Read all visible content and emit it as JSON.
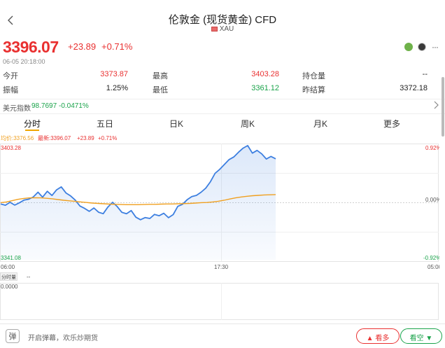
{
  "header": {
    "title": "伦敦金 (现货黄金) CFD",
    "code": "XAU",
    "back_icon": "chevron-left-icon"
  },
  "quote": {
    "price": "3396.07",
    "change": "+23.89",
    "change_pct": "+0.71%",
    "datetime": "06-05 20:18:00"
  },
  "stats": [
    {
      "label": "今开",
      "value": "3373.87",
      "label2": "最高",
      "value2": "3403.28",
      "label3": "持仓量",
      "value3": "--"
    },
    {
      "label": "振幅",
      "value": "1.25%",
      "label2": "最低",
      "value2": "3361.12",
      "label3": "昨结算",
      "value3": "3372.18"
    }
  ],
  "usd_index": {
    "label": "美元指数",
    "value": "98.7697",
    "change_pct": "-0.0471%"
  },
  "tabs": [
    "分时",
    "五日",
    "日K",
    "周K",
    "月K",
    "更多"
  ],
  "active_tab": 0,
  "chart_legend": {
    "avg": "均价:3376.56",
    "latest": "最新:3396.07",
    "change": "+23.89",
    "change_pct": "+0.71%"
  },
  "chart_data": {
    "type": "line",
    "y_max_label": "3403.28",
    "y_min_label": "3341.08",
    "pct_top": "0.92%",
    "pct_mid": "0.00%",
    "pct_bottom": "-0.92%",
    "x_labels": [
      "06:00",
      "17:30",
      "05:00"
    ],
    "ylim": [
      3341.08,
      3403.28
    ],
    "prev_close": 3372.18,
    "series": [
      {
        "values": [
          3371.5,
          3370.8,
          3372.4,
          3370.9,
          3372.1,
          3373.6,
          3374.1,
          3375.3,
          3377.9,
          3375.2,
          3378.4,
          3376.1,
          3379.2,
          3380.8,
          3377.5,
          3375.9,
          3373.6,
          3370.4,
          3369.1,
          3367.5,
          3369.3,
          3367.0,
          3366.2,
          3369.8,
          3372.4,
          3370.1,
          3366.9,
          3366.2,
          3367.9,
          3364.3,
          3362.9,
          3364.1,
          3363.6,
          3365.8,
          3365.1,
          3366.4,
          3364.0,
          3365.7,
          3370.2,
          3371.3,
          3373.8,
          3375.5,
          3376.2,
          3377.9,
          3380.1,
          3383.6,
          3388.2,
          3390.4,
          3393.0,
          3395.7,
          3397.1,
          3399.6,
          3401.9,
          3403.3,
          3399.2,
          3400.7,
          3398.8,
          3396.0,
          3397.4,
          3396.1
        ]
      },
      {
        "values": [
          3372.2,
          3372.6,
          3373.3,
          3374.0,
          3374.5,
          3374.8,
          3374.9,
          3374.8,
          3374.6,
          3374.3,
          3373.9,
          3373.5,
          3373.2,
          3372.9,
          3372.6,
          3372.3,
          3372.0,
          3371.8,
          3371.6,
          3371.4,
          3371.3,
          3371.2,
          3371.1,
          3371.1,
          3371.1,
          3371.2,
          3371.3,
          3371.3,
          3371.4,
          3371.5,
          3371.5,
          3371.6,
          3371.7,
          3371.8,
          3372.0,
          3372.2,
          3372.3,
          3372.6,
          3373.0,
          3373.5,
          3374.2,
          3374.8,
          3375.3,
          3375.7,
          3376.0,
          3376.2,
          3376.4,
          3376.5,
          3376.6
        ]
      }
    ]
  },
  "volume": {
    "label": "分时量",
    "value": "--",
    "axis": "0.0000"
  },
  "bottom": {
    "danmu_icon": "弹",
    "danmu_text": "开启弹幕，欢乐炒期货",
    "bull": "看多",
    "bear": "看空"
  },
  "colors": {
    "up": "#e93030",
    "down": "#1aa34a",
    "line": "#3d7fe0",
    "avg": "#f0a020"
  }
}
